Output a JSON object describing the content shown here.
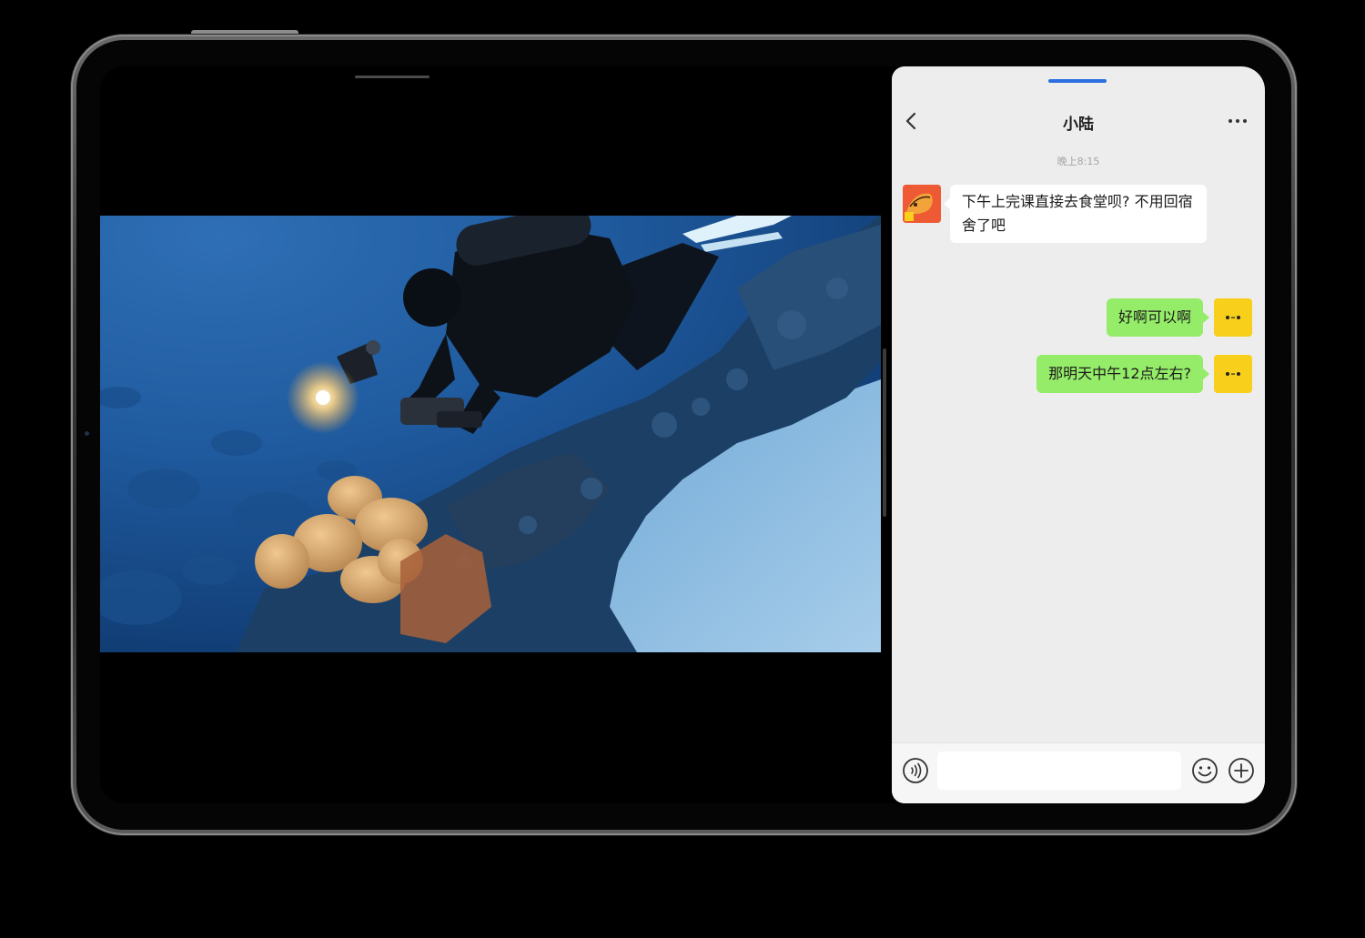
{
  "colors": {
    "chat_background": "#ededed",
    "incoming_bubble": "#ffffff",
    "outgoing_bubble": "#95ec69",
    "accent_handle": "#2c6fe0",
    "peer_avatar": "#ee5a34",
    "self_avatar": "#f8cf1a"
  },
  "video_app": {
    "scene": "underwater-diver-photographing-coral"
  },
  "chat": {
    "title": "小陆",
    "timestamp": "晚上8:15",
    "back_icon": "chevron-left-icon",
    "more_icon": "more-dots-icon",
    "messages": [
      {
        "from": "peer",
        "text": "下午上完课直接去食堂呗? 不用回宿舍了吧"
      },
      {
        "from": "self",
        "text": "好啊可以啊"
      },
      {
        "from": "self",
        "text": "那明天中午12点左右?"
      }
    ],
    "input": {
      "value": "",
      "voice_icon": "voice-icon",
      "emoji_icon": "emoji-icon",
      "plus_icon": "plus-circle-icon"
    }
  }
}
